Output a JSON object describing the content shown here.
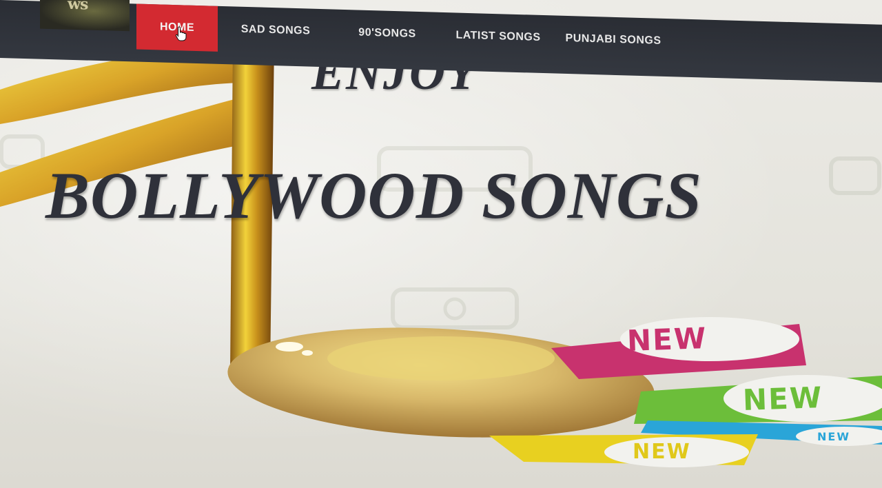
{
  "logo": {
    "text": "ws"
  },
  "nav": {
    "items": [
      {
        "label": "HOME",
        "active": true
      },
      {
        "label": "SAD SONGS",
        "active": false
      },
      {
        "label": "90'SONGS",
        "active": false
      },
      {
        "label": "LATIST SONGS",
        "active": false
      },
      {
        "label": "PUNJABI SONGS",
        "active": false
      }
    ]
  },
  "hero": {
    "line1": "ENJOY",
    "line2": "BOLLYWOOD SONGS",
    "badges": [
      {
        "label": "NEW",
        "color": "#c8326e"
      },
      {
        "label": "NEW",
        "color": "#6cbe3a"
      },
      {
        "label": "NEW",
        "color": "#2aa5d8"
      },
      {
        "label": "NEW",
        "color": "#e8d020"
      }
    ]
  },
  "colors": {
    "nav_bg": "#30333a",
    "nav_active": "#d32a31",
    "headline": "#2f313a",
    "note_gold": "#d4a82a"
  },
  "icons": {
    "cursor": "hand-pointer-icon",
    "note": "music-note-icon"
  }
}
